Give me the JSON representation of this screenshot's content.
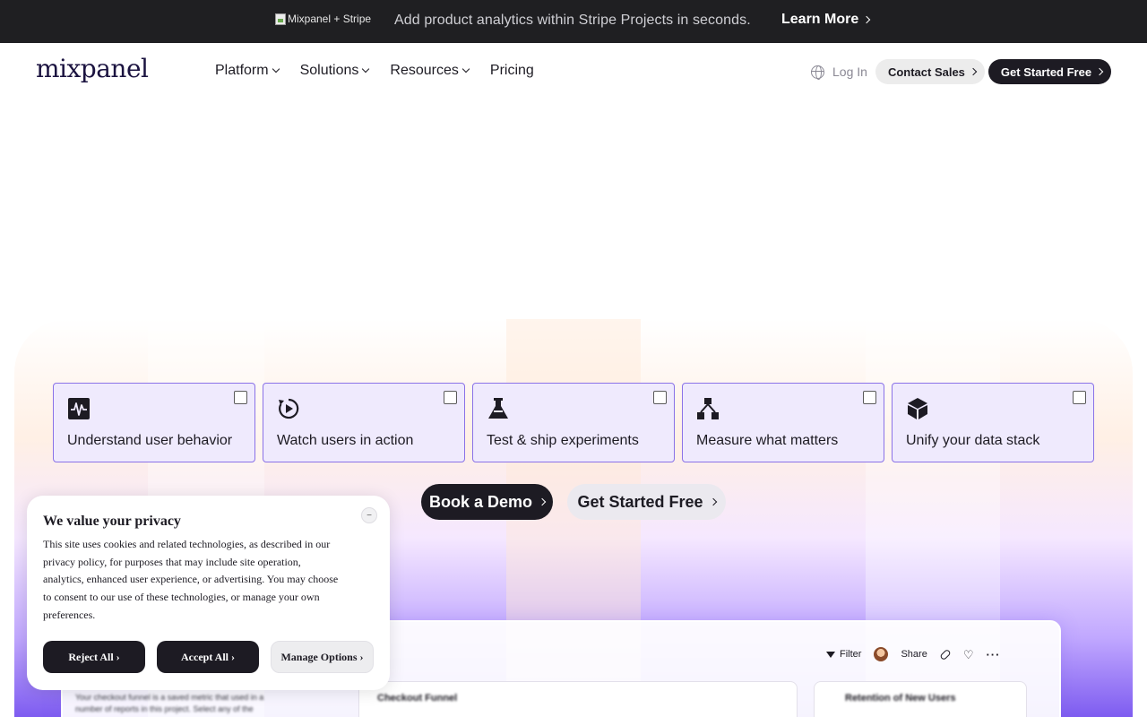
{
  "promo": {
    "logo_alt": "Mixpanel + Stripe",
    "text": "Add product analytics within Stripe Projects in seconds.",
    "link": "Learn More"
  },
  "header": {
    "logo": "mixpanel",
    "nav": [
      {
        "label": "Platform",
        "dropdown": true
      },
      {
        "label": "Solutions",
        "dropdown": true
      },
      {
        "label": "Resources",
        "dropdown": true
      },
      {
        "label": "Pricing",
        "dropdown": false
      }
    ],
    "login": "Log In",
    "contact_sales": "Contact Sales",
    "get_started": "Get Started Free"
  },
  "features": [
    {
      "label": "Understand user behavior",
      "icon": "waveform-icon",
      "checked": false
    },
    {
      "label": "Watch users in action",
      "icon": "replay-icon",
      "checked": false
    },
    {
      "label": "Test & ship experiments",
      "icon": "flask-icon",
      "checked": false
    },
    {
      "label": "Measure what matters",
      "icon": "hierarchy-icon",
      "checked": false
    },
    {
      "label": "Unify your data stack",
      "icon": "cube-icon",
      "checked": false
    }
  ],
  "hero": {
    "book_demo": "Book a Demo",
    "get_started": "Get Started Free"
  },
  "dashboard": {
    "toolbar": {
      "filter": "Filter",
      "share": "Share"
    },
    "cards": [
      {
        "title": "Checkout Funnel"
      },
      {
        "title": "Retention of New Users"
      }
    ],
    "description": "Your checkout funnel is a saved metric that used in a number of reports in this project. Select any of the"
  },
  "cookie": {
    "title": "We value your privacy",
    "close": "−",
    "body": "This site uses cookies and related technologies, as described in our privacy policy, for purposes that may include site operation, analytics, enhanced user experience, or advertising. You may choose to consent to our use of these technologies, or manage your own preferences.",
    "reject": "Reject All",
    "accept": "Accept All",
    "manage": "Manage Options"
  },
  "colors": {
    "dark": "#1d1b23",
    "accent_purple": "#7e5cf0",
    "card_border": "#8a72e8",
    "card_fill": "#efeafd"
  }
}
